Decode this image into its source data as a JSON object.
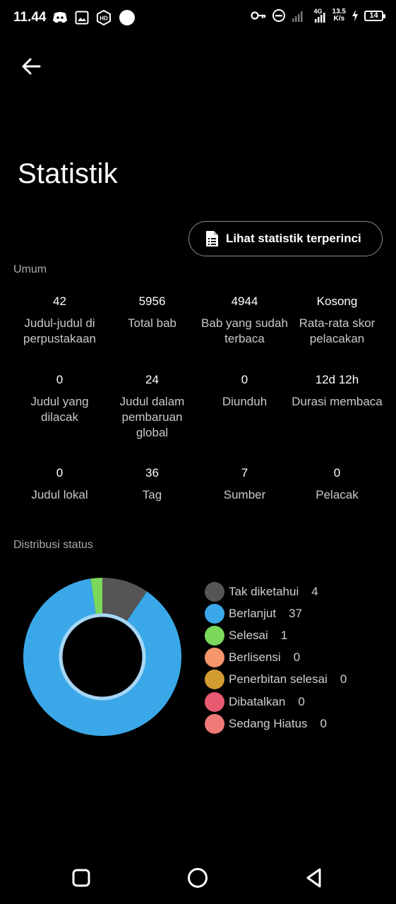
{
  "status_bar": {
    "time": "11.44",
    "net_speed_top": "13.5",
    "net_speed_bottom": "K/s",
    "network_type": "4G",
    "battery": "14"
  },
  "header": {
    "back_icon": "arrow-left-icon",
    "title": "Statistik"
  },
  "detail_button": {
    "icon": "document-list-icon",
    "label": "Lihat statistik terperinci"
  },
  "general": {
    "section_label": "Umum",
    "stats": [
      {
        "value": "42",
        "label": "Judul-judul di perpustakaan"
      },
      {
        "value": "5956",
        "label": "Total bab"
      },
      {
        "value": "4944",
        "label": "Bab yang sudah terbaca"
      },
      {
        "value": "Kosong",
        "label": "Rata-rata skor pelacakan"
      },
      {
        "value": "0",
        "label": "Judul yang dilacak"
      },
      {
        "value": "24",
        "label": "Judul dalam pembaruan global"
      },
      {
        "value": "0",
        "label": "Diunduh"
      },
      {
        "value": "12d 12h",
        "label": "Durasi membaca"
      },
      {
        "value": "0",
        "label": "Judul lokal"
      },
      {
        "value": "36",
        "label": "Tag"
      },
      {
        "value": "7",
        "label": "Sumber"
      },
      {
        "value": "0",
        "label": "Pelacak"
      }
    ]
  },
  "distribution": {
    "section_label": "Distribusi status"
  },
  "chart_data": {
    "type": "pie",
    "categories": [
      "Tak diketahui",
      "Berlanjut",
      "Selesai",
      "Berlisensi",
      "Penerbitan selesai",
      "Dibatalkan",
      "Sedang Hiatus"
    ],
    "values": [
      4,
      37,
      1,
      0,
      0,
      0,
      0
    ],
    "colors": [
      "#555555",
      "#3aa8e8",
      "#7bd85a",
      "#f5956a",
      "#d39c30",
      "#e85a72",
      "#f07a78"
    ],
    "legend_placement": "right"
  },
  "nav_bar": {
    "recent_icon": "square-recent-apps-icon",
    "home_icon": "circle-home-icon",
    "back_icon": "triangle-back-icon"
  }
}
